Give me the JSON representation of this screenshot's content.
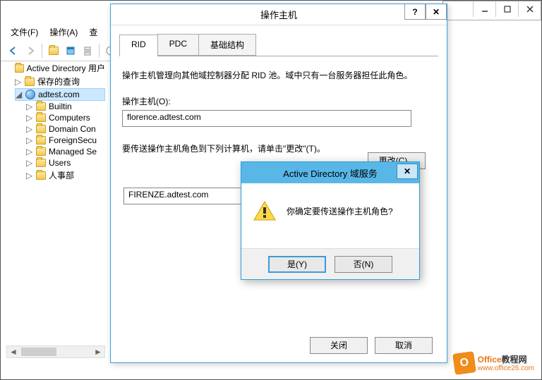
{
  "menubar": {
    "file": "文件(F)",
    "action": "操作(A)",
    "view": "查"
  },
  "tree": {
    "root": "Active Directory 用户",
    "saved_queries": "保存的查询",
    "domain": "adtest.com",
    "items": [
      "Builtin",
      "Computers",
      "Domain Con",
      "ForeignSecu",
      "Managed Se",
      "Users",
      "人事部"
    ]
  },
  "dialog1": {
    "title": "操作主机",
    "tabs": {
      "rid": "RID",
      "pdc": "PDC",
      "infra": "基础结构"
    },
    "desc": "操作主机管理向其他域控制器分配 RID 池。域中只有一台服务器担任此角色。",
    "master_label": "操作主机(O):",
    "master_value": "florence.adtest.com",
    "instruction": "要传送操作主机角色到下列计算机，请单击\"更改\"(T)。",
    "change_btn": "更改(C)...",
    "target_value": "FIRENZE.adtest.com",
    "close_btn": "关闭",
    "cancel_btn": "取消"
  },
  "dialog2": {
    "title": "Active Directory 域服务",
    "message": "你确定要传送操作主机角色?",
    "yes": "是(Y)",
    "no": "否(N)"
  },
  "watermark": {
    "line1a": "Office",
    "line1b": "教程网",
    "line2": "www.office26.com"
  }
}
